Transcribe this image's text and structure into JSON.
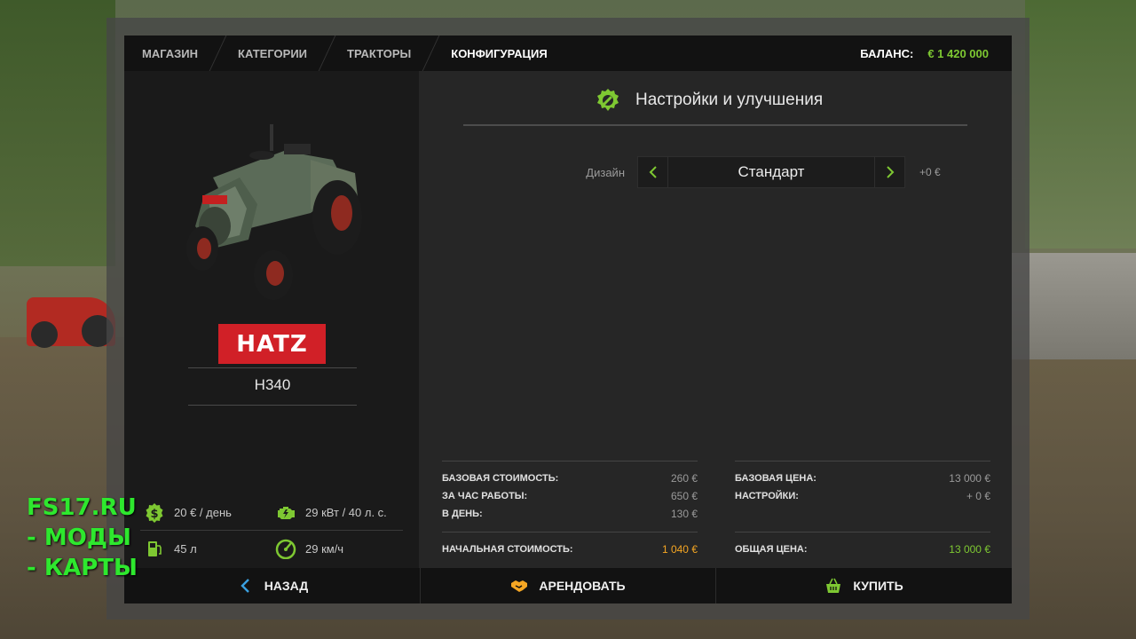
{
  "breadcrumb": [
    "МАГАЗИН",
    "КАТЕГОРИИ",
    "ТРАКТОРЫ",
    "КОНФИГУРАЦИЯ"
  ],
  "balance": {
    "label": "БАЛАНС:",
    "value": "€ 1 420 000"
  },
  "vehicle": {
    "brand": "HATZ",
    "model": "H340",
    "specs": {
      "rent_per_day": "20 € / день",
      "power": "29 кВт / 40 л. с.",
      "fuel": "45 л",
      "speed": "29 км/ч"
    }
  },
  "settings": {
    "title": "Настройки и улучшения",
    "design_label": "Дизайн",
    "design_value": "Стандарт",
    "design_price": "+0 €"
  },
  "costs": {
    "base_cost_label": "БАЗОВАЯ СТОИМОСТЬ:",
    "base_cost_value": "260 €",
    "per_hour_label": "ЗА ЧАС РАБОТЫ:",
    "per_hour_value": "650 €",
    "per_day_label": "В ДЕНЬ:",
    "per_day_value": "130 €",
    "initial_label": "НАЧАЛЬНАЯ СТОИМОСТЬ:",
    "initial_value": "1 040 €",
    "base_price_label": "БАЗОВАЯ ЦЕНА:",
    "base_price_value": "13 000 €",
    "settings_label": "НАСТРОЙКИ:",
    "settings_value": "+ 0 €",
    "total_label": "ОБЩАЯ ЦЕНА:",
    "total_value": "13 000 €"
  },
  "buttons": {
    "back": "НАЗАД",
    "lease": "АРЕНДОВАТЬ",
    "buy": "КУПИТЬ"
  },
  "watermark": [
    "FS17.RU",
    "- МОДЫ",
    "- КАРТЫ"
  ],
  "colors": {
    "accent": "#7ec832",
    "orange": "#f5a623",
    "blue": "#3aa0e0",
    "brand_red": "#d12027"
  }
}
